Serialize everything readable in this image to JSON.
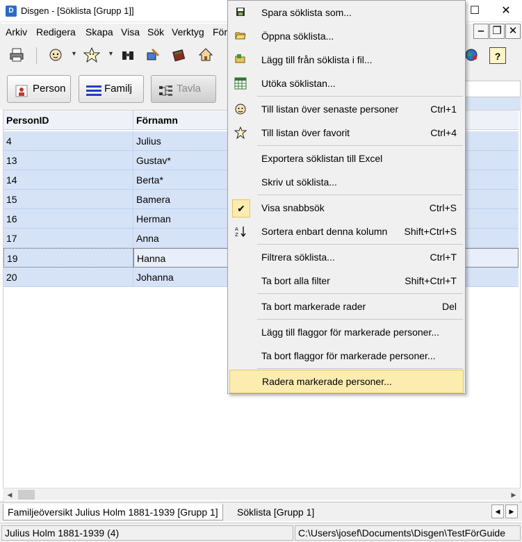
{
  "window": {
    "title": "Disgen - [Söklista [Grupp 1]]",
    "controls": {
      "maximize": "☐",
      "close": "✕"
    }
  },
  "menubar": {
    "items": [
      "Arkiv",
      "Redigera",
      "Skapa",
      "Visa",
      "Sök",
      "Verktyg",
      "För"
    ]
  },
  "mdi_controls": {
    "minimize": "‒",
    "restore": "❐",
    "close": "✕"
  },
  "toolbar": {
    "icons": [
      "printer-icon",
      "person-face-icon",
      "favorite-person-icon",
      "binoculars-icon",
      "edit-hand-icon",
      "book-icon",
      "home-icon",
      "globe-icon",
      "help-icon"
    ],
    "help_glyph": "?"
  },
  "modebar": {
    "buttons": [
      {
        "label": "Person"
      },
      {
        "label": "Familj"
      },
      {
        "label": "Tavla",
        "disabled": true
      }
    ]
  },
  "grid": {
    "columns": [
      "PersonID",
      "Förnamn"
    ],
    "rows": [
      {
        "id": "4",
        "name": "Julius"
      },
      {
        "id": "13",
        "name": "Gustav*"
      },
      {
        "id": "14",
        "name": "Berta*"
      },
      {
        "id": "15",
        "name": "Bamera"
      },
      {
        "id": "16",
        "name": "Herman"
      },
      {
        "id": "17",
        "name": "Anna"
      },
      {
        "id": "19",
        "name": "Hanna"
      },
      {
        "id": "20",
        "name": "Johanna"
      }
    ],
    "focused_row_index": 6
  },
  "tabs": {
    "items": [
      {
        "label": "Familjeöversikt Julius Holm 1881-1939 [Grupp 1]",
        "active": true
      },
      {
        "label": "Söklista [Grupp 1]",
        "active": false
      }
    ]
  },
  "statusbar": {
    "person": "Julius Holm 1881-1939 (4)",
    "path": "C:\\Users\\josef\\Documents\\Disgen\\TestFörGuide"
  },
  "context_menu": {
    "items": [
      {
        "label": "Spara söklista som...",
        "shortcut": "",
        "icon": "save-list-icon"
      },
      {
        "label": "Öppna söklista...",
        "shortcut": "",
        "icon": "open-folder-icon"
      },
      {
        "label": "Lägg till från söklista i fil...",
        "shortcut": "",
        "icon": "add-from-file-icon"
      },
      {
        "label": "Utöka söklistan...",
        "shortcut": "",
        "icon": "extend-list-icon"
      },
      {
        "label": "Till listan över senaste personer",
        "shortcut": "Ctrl+1",
        "icon": "recent-person-icon"
      },
      {
        "label": "Till listan över favorit",
        "shortcut": "Ctrl+4",
        "icon": "favorite-person-icon"
      },
      {
        "label": "Exportera söklistan till Excel",
        "shortcut": "",
        "icon": ""
      },
      {
        "label": "Skriv ut söklista...",
        "shortcut": "",
        "icon": ""
      },
      {
        "label": "Visa snabbsök",
        "shortcut": "Ctrl+S",
        "icon": "check-icon",
        "checked": true
      },
      {
        "label": "Sortera enbart denna kolumn",
        "shortcut": "Shift+Ctrl+S",
        "icon": "sort-icon"
      },
      {
        "label": "Filtrera söklista...",
        "shortcut": "Ctrl+T",
        "icon": ""
      },
      {
        "label": "Ta bort alla filter",
        "shortcut": "Shift+Ctrl+T",
        "icon": ""
      },
      {
        "label": "Ta bort markerade rader",
        "shortcut": "Del",
        "icon": ""
      },
      {
        "label": "Lägg till flaggor för markerade personer...",
        "shortcut": "",
        "icon": ""
      },
      {
        "label": "Ta bort flaggor för markerade personer...",
        "shortcut": "",
        "icon": ""
      },
      {
        "label": "Radera markerade personer...",
        "shortcut": "",
        "icon": "",
        "highlighted": true
      }
    ]
  },
  "colors": {
    "row_selected": "#d6e3f7",
    "menu_highlight": "#fcecb0",
    "menu_highlight_border": "#e5c365"
  }
}
